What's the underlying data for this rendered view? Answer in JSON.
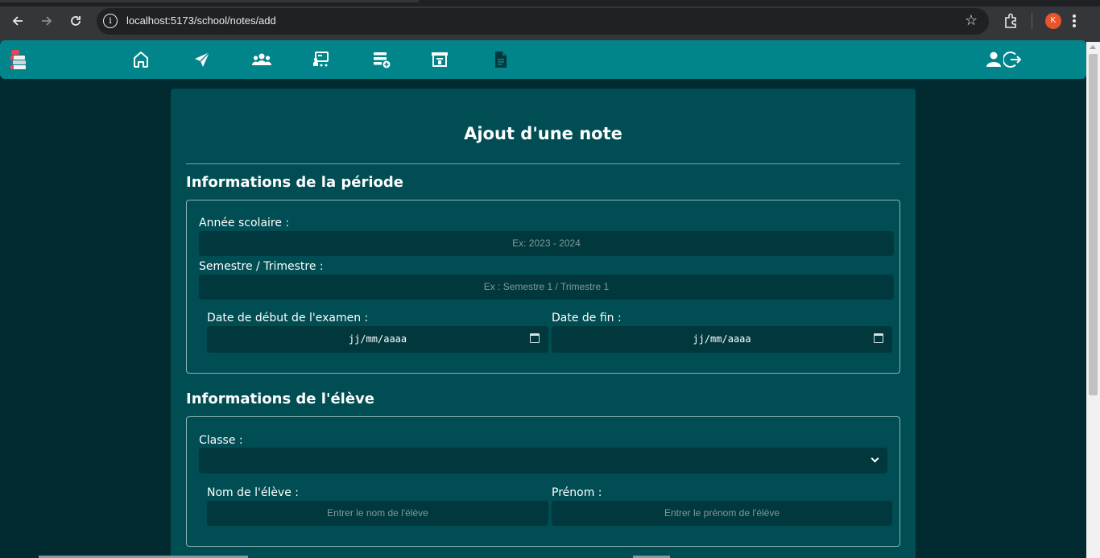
{
  "browser": {
    "url": "localhost:5173/school/notes/add",
    "avatar_letter": "K",
    "icons": [
      "back-arrow-icon",
      "forward-arrow-icon",
      "reload-icon",
      "site-info-icon",
      "bookmark-star-icon",
      "extensions-icon",
      "kebab-menu-icon"
    ]
  },
  "navbar": {
    "bg_color": "#02848b",
    "icons": [
      "home-icon",
      "send-icon",
      "users-icon",
      "classes-icon",
      "add-list-icon",
      "notes-board-icon",
      "document-icon",
      "profile-icon",
      "logout-icon"
    ]
  },
  "form": {
    "title": "Ajout d'une note",
    "period_section": {
      "title": "Informations de la période",
      "school_year_label": "Année scolaire :",
      "school_year_placeholder": "Ex: 2023 - 2024",
      "semester_label": "Semestre / Trimestre :",
      "semester_placeholder": "Ex : Semestre 1 / Trimestre 1",
      "start_date_label": "Date de début de l'examen :",
      "start_date_value": "jj/mm/aaaa",
      "end_date_label": "Date de fin :",
      "end_date_value": "jj/mm/aaaa"
    },
    "student_section": {
      "title": "Informations de l'élève",
      "class_label": "Classe :",
      "class_selected": "",
      "last_name_label": "Nom de l'élève :",
      "last_name_placeholder": "Entrer le nom de l'élève",
      "first_name_label": "Prénom :",
      "first_name_placeholder": "Entrer le prénom de l'élève"
    }
  }
}
